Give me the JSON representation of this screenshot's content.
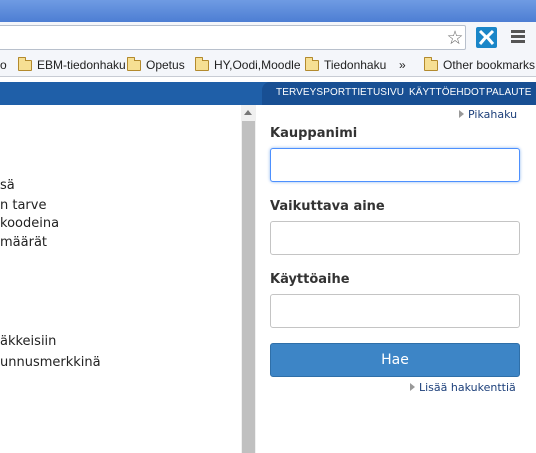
{
  "browser": {
    "bookmarks": [
      {
        "label": "o"
      },
      {
        "label": "EBM-tiedonhaku"
      },
      {
        "label": "Opetus"
      },
      {
        "label": "HY,Oodi,Moodle"
      },
      {
        "label": "Tiedonhaku"
      }
    ],
    "overflow": "»",
    "other_bookmarks": "Other bookmarks",
    "icons": {
      "star": "star-icon",
      "extension": "extension-icon",
      "menu": "menu-icon"
    }
  },
  "nav": {
    "links": [
      "TERVEYSPORTTI",
      "ETUSIVU",
      "KÄYTTÖEHDOT",
      "PALAUTE"
    ]
  },
  "left": {
    "lines": [
      "sä",
      "n tarve",
      "koodeina",
      "määrät",
      "äkkeisiin",
      "unnusmerkkinä"
    ]
  },
  "search": {
    "quick_link": "Pikahaku",
    "fields": [
      {
        "label": "Kauppanimi",
        "value": ""
      },
      {
        "label": "Vaikuttava aine",
        "value": ""
      },
      {
        "label": "Käyttöaihe",
        "value": ""
      }
    ],
    "submit": "Hae",
    "more_fields": "Lisää hakukenttiä"
  },
  "colors": {
    "navbar": "#1f5fa8",
    "button": "#3d85c6",
    "focus": "#4d90fe"
  }
}
